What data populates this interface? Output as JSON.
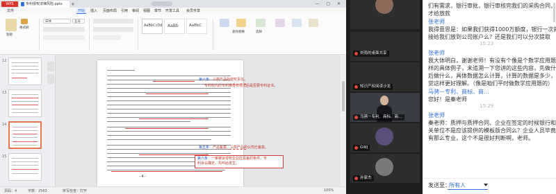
{
  "wps": {
    "logo": "WPS Office",
    "doc_tab": "专利侵权法律风险.pptx",
    "add_tab": "+",
    "window_buttons": "— ▢ ✕",
    "menu": [
      "文件",
      "开始",
      "插入",
      "页面布局",
      "引用",
      "审阅",
      "视图",
      "章节",
      "开发工具",
      "会员专享"
    ],
    "active_menu_index": 1,
    "ribbon": {
      "paste": "粘贴",
      "clipboard": "格式刷",
      "font_name": "宋体",
      "font_size": "五号",
      "styles": [
        "AaBbCcDd",
        "AaBb",
        "AaBbC"
      ],
      "find": "查找替换",
      "select": "选择"
    },
    "thumbs": [
      "12",
      "13",
      "14",
      "15"
    ],
    "selected_thumb_index": 2,
    "page_number": "- 4 -",
    "comments": [
      {
        "tag": "第六条：",
        "text": "三款产品的侵权责任。"
      },
      {
        "tag": "",
        "text": "专利权内的专利被侵权情况后是否要专利证书。"
      },
      {
        "tag": "第五条：",
        "text": "产品备案、三款产品的公司已备案。"
      },
      {
        "tag": "第六条：",
        "text": "一审被诉侵权企业应具备的条件，专"
      },
      {
        "tag": "",
        "text": "利诉讼确定，先叫给发生。"
      }
    ],
    "status": {
      "page": "页码：4",
      "words": "字数：2563",
      "spell": "拼写检查：打开",
      "zoom": "100%"
    }
  },
  "videos": [
    {
      "name": "刘雨的桌面共享"
    },
    {
      "name": "知识产权阅读沙龙"
    },
    {
      "name": "马骋－专利、商标、商…"
    },
    {
      "name": "GWJ"
    },
    {
      "name": "孙家杰"
    }
  ],
  "chat": {
    "lines": [
      {
        "text": "们有需求，银行审批，银行审核完我们的采购合同，",
        "type": "msg"
      },
      {
        "text": "才给放款",
        "type": "msg"
      },
      {
        "text": "张老师",
        "type": "sender"
      },
      {
        "text": "我得意思是：如果我们获得1000万额度，银行一次就直",
        "type": "msg"
      },
      {
        "text": "接给我们放到公司账户么？还是我们可以分次提取",
        "type": "msg"
      },
      {
        "text": "15:23",
        "type": "time"
      },
      {
        "text": "张老师",
        "type": "sender"
      },
      {
        "text": "我大体明白，谢谢老师！有没有个像是个数学应用题一",
        "type": "msg"
      },
      {
        "text": "样的具体例子，未追溯一下您讲的这些内容，先做什么",
        "type": "msg"
      },
      {
        "text": "后做什么，具体数据怎么计算，计算的数据是多少，感",
        "type": "msg"
      },
      {
        "text": "觉这样更好理解。（像是咱们平时做数学应用题的）",
        "type": "msg"
      },
      {
        "text": "马骋－专利、商标、商…",
        "type": "sender"
      },
      {
        "text": "您好！是秦老师",
        "type": "msg"
      },
      {
        "text": "15:29",
        "type": "time"
      },
      {
        "text": "张老师",
        "type": "sender"
      },
      {
        "text": "秦老师：质押与质押合同、企业在签定的时候银行和相",
        "type": "msg"
      },
      {
        "text": "关单位不是应该提供的模板版合同么？企业人员毕竟没",
        "type": "msg"
      },
      {
        "text": "有那么专业，这个不是很好判断啊，老师。",
        "type": "msg"
      }
    ],
    "send_label": "发送至：",
    "send_target": "所有人"
  }
}
